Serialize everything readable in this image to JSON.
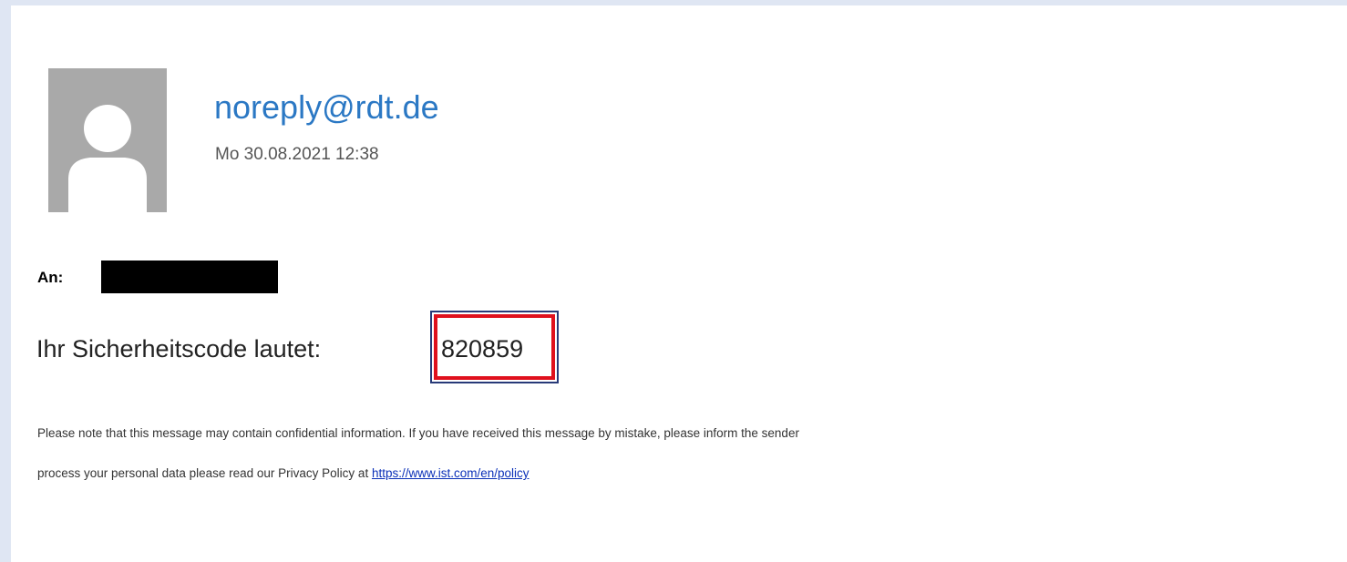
{
  "email": {
    "sender": "noreply@rdt.de",
    "date": "Mo 30.08.2021 12:38",
    "to_label": "An:",
    "code_prefix": "Ihr Sicherheitscode lautet:",
    "code": "820859",
    "disclaimer_line1": "Please note that this message may contain confidential information. If you have received this message by mistake, please inform the sender",
    "disclaimer_line2_prefix": "process your personal data please read our Privacy Policy at ",
    "policy_link": "https://www.ist.com/en/policy"
  },
  "colors": {
    "background": "#dfe6f3",
    "sender_link": "#2b78c4",
    "highlight_box": "#e0111d",
    "policy_link": "#0b30b8"
  },
  "icons": {
    "avatar": "default-person-avatar"
  }
}
